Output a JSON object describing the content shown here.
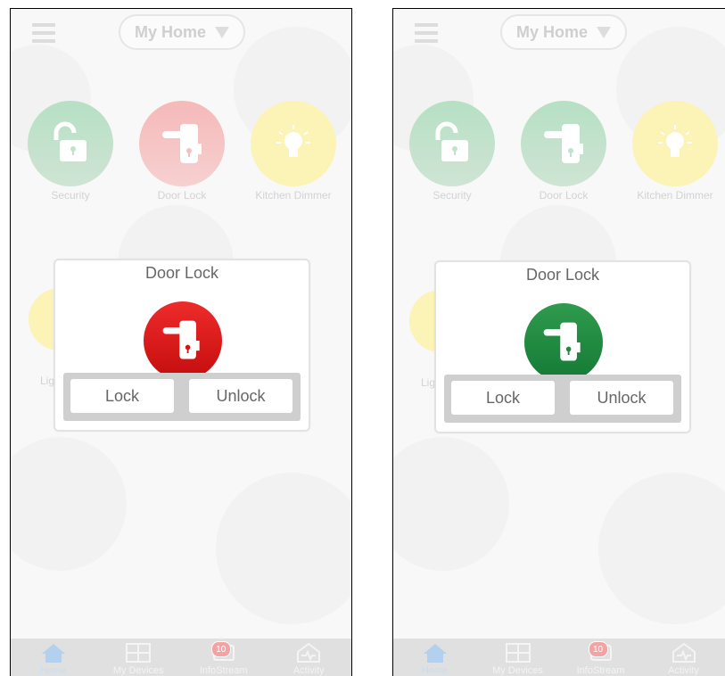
{
  "header": {
    "home_label": "My Home"
  },
  "devices": [
    {
      "name": "Security",
      "icon": "padlock-open-icon",
      "color": "#b6e0c4"
    },
    {
      "name": "Door Lock",
      "icon": "door-handle-icon",
      "color": "#f5b9b9"
    },
    {
      "name": "Kitchen Dimmer",
      "icon": "light-bulb-icon",
      "color": "#fcf3b6"
    }
  ],
  "partial_device": {
    "label": "Lig"
  },
  "dialog": {
    "title": "Door Lock",
    "lock_label": "Lock",
    "unlock_label": "Unlock"
  },
  "left_screen": {
    "door_lock_state": "locked",
    "badge_color": "#e21b1b"
  },
  "right_screen": {
    "door_lock_state": "unlocked",
    "badge_color": "#1f8a41",
    "door_lock_tile_color": "#b6e0c4"
  },
  "tabs": [
    {
      "label": "Home",
      "icon": "house-icon",
      "active": true
    },
    {
      "label": "My Devices",
      "icon": "grid-icon"
    },
    {
      "label": "InfoStream",
      "icon": "infostream-icon",
      "badge": "10"
    },
    {
      "label": "Activity",
      "icon": "activity-icon"
    }
  ]
}
